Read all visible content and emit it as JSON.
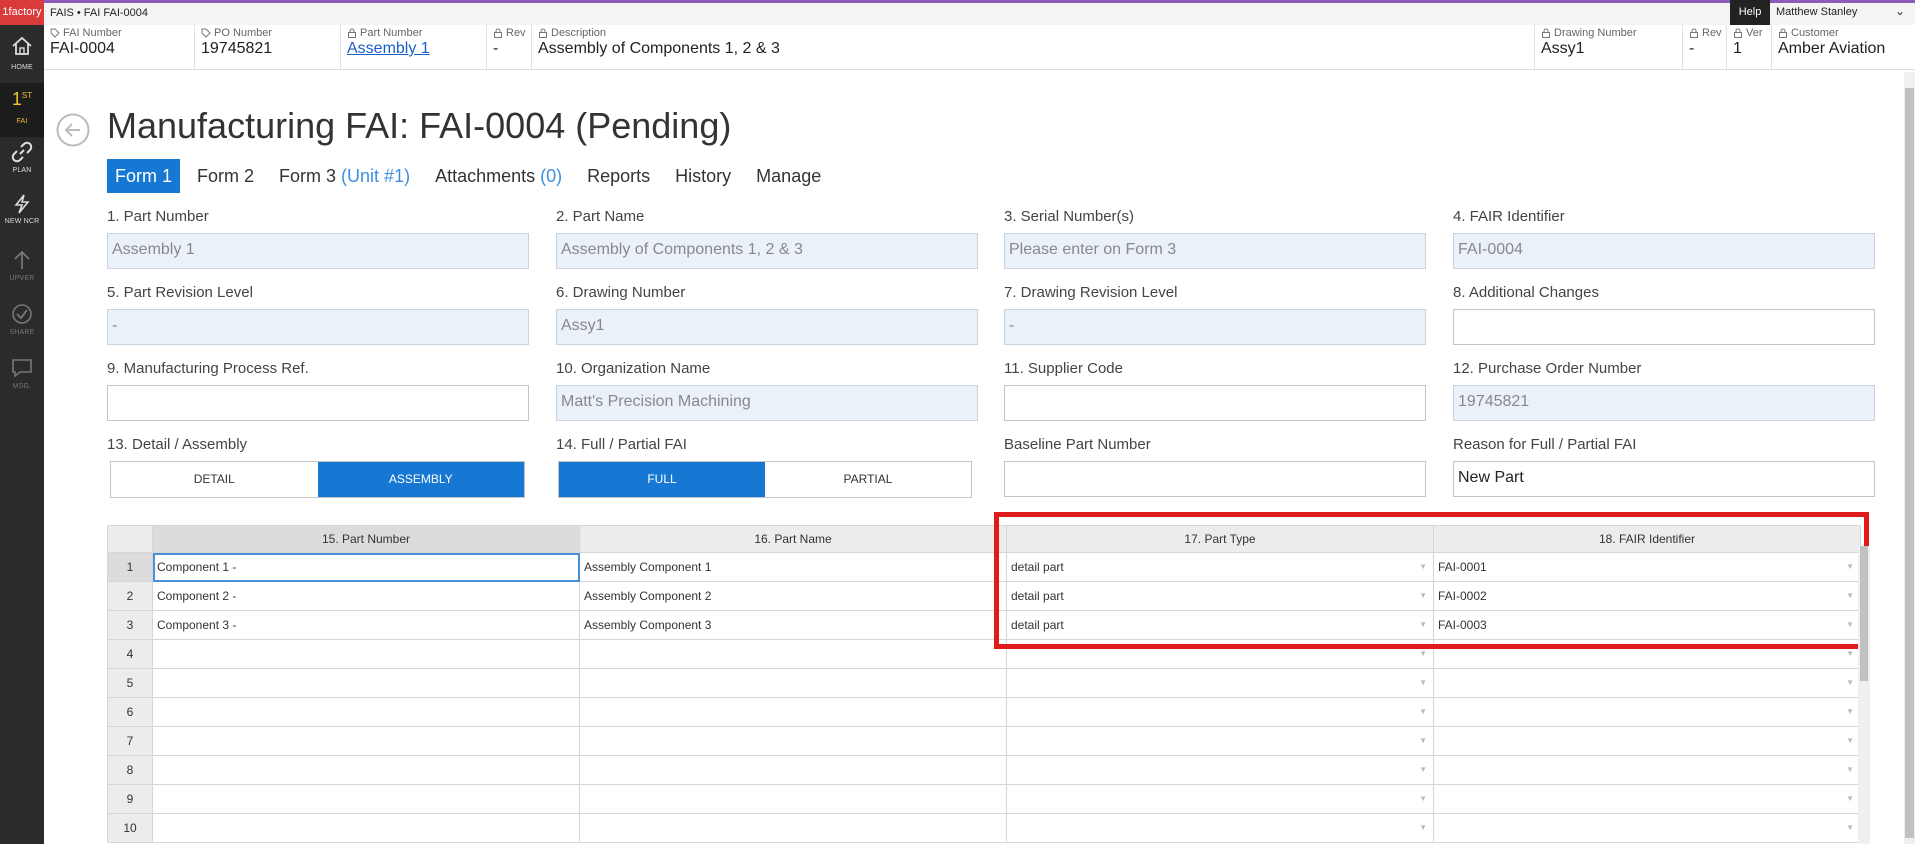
{
  "topbar": {
    "logo": "1factory",
    "breadcrumb": "FAIS • FAI FAI-0004",
    "help": "Help",
    "user": "Matthew Stanley"
  },
  "header_fields": [
    {
      "label": "FAI Number",
      "value": "FAI-0004",
      "icon": "tag-icon"
    },
    {
      "label": "PO Number",
      "value": "19745821",
      "icon": "tag-icon"
    },
    {
      "label": "Part Number",
      "value": "Assembly 1",
      "icon": "lock-icon"
    },
    {
      "label": "Rev",
      "value": "-",
      "icon": "lock-icon"
    },
    {
      "label": "Description",
      "value": "Assembly of Components 1, 2 & 3",
      "icon": "lock-icon"
    },
    {
      "label": "Drawing Number",
      "value": "Assy1",
      "icon": "lock-icon"
    },
    {
      "label": "Rev",
      "value": "-",
      "icon": "lock-icon"
    },
    {
      "label": "Ver",
      "value": "1",
      "icon": "lock-icon"
    },
    {
      "label": "Customer",
      "value": "Amber Aviation",
      "icon": "lock-icon"
    }
  ],
  "sidebar": [
    {
      "label": "HOME",
      "icon": "home-icon"
    },
    {
      "label": "FAI",
      "icon": "first-fai-icon",
      "badge": "1",
      "sup": "ST"
    },
    {
      "label": "PLAN",
      "icon": "link-icon"
    },
    {
      "label": "NEW NCR",
      "icon": "lightning-icon"
    },
    {
      "label": "UPVER",
      "icon": "up-arrow-icon"
    },
    {
      "label": "SHARE",
      "icon": "check-circle-icon"
    },
    {
      "label": "MSG.",
      "icon": "chat-icon"
    }
  ],
  "page": {
    "title": "Manufacturing FAI: FAI-0004 (Pending)"
  },
  "tabs": [
    {
      "label": "Form 1",
      "sub": ""
    },
    {
      "label": "Form 2",
      "sub": ""
    },
    {
      "label": "Form 3",
      "sub": " (Unit #1)"
    },
    {
      "label": "Attachments",
      "sub": " (0)"
    },
    {
      "label": "Reports",
      "sub": ""
    },
    {
      "label": "History",
      "sub": ""
    },
    {
      "label": "Manage",
      "sub": ""
    }
  ],
  "form": {
    "f1": {
      "label": "1. Part Number",
      "value": "Assembly 1"
    },
    "f2": {
      "label": "2. Part Name",
      "value": "Assembly of Components 1, 2 & 3"
    },
    "f3": {
      "label": "3. Serial Number(s)",
      "value": "Please enter on Form 3"
    },
    "f4": {
      "label": "4. FAIR Identifier",
      "value": "FAI-0004"
    },
    "f5": {
      "label": "5. Part Revision Level",
      "value": "-"
    },
    "f6": {
      "label": "6. Drawing Number",
      "value": "Assy1"
    },
    "f7": {
      "label": "7. Drawing Revision Level",
      "value": "-"
    },
    "f8": {
      "label": "8. Additional Changes",
      "value": ""
    },
    "f9": {
      "label": "9. Manufacturing Process Ref.",
      "value": ""
    },
    "f10": {
      "label": "10. Organization Name",
      "value": "Matt's Precision Machining"
    },
    "f11": {
      "label": "11. Supplier Code",
      "value": ""
    },
    "f12": {
      "label": "12. Purchase Order Number",
      "value": "19745821"
    },
    "f13": {
      "label": "13. Detail / Assembly",
      "options": [
        "DETAIL",
        "ASSEMBLY"
      ],
      "selected": "ASSEMBLY"
    },
    "f14": {
      "label": "14. Full / Partial FAI",
      "options": [
        "FULL",
        "PARTIAL"
      ],
      "selected": "FULL"
    },
    "baseline": {
      "label": "Baseline Part Number",
      "value": ""
    },
    "reason": {
      "label": "Reason for Full / Partial FAI",
      "value": "New Part"
    }
  },
  "grid": {
    "columns": [
      "15. Part Number",
      "16. Part Name",
      "17. Part Type",
      "18. FAIR Identifier"
    ],
    "rows": [
      [
        "1",
        "Component 1 -",
        "Assembly Component 1",
        "detail part",
        "FAI-0001"
      ],
      [
        "2",
        "Component 2 -",
        "Assembly Component 2",
        "detail part",
        "FAI-0002"
      ],
      [
        "3",
        "Component 3 -",
        "Assembly Component 3",
        "detail part",
        "FAI-0003"
      ],
      [
        "4",
        "",
        "",
        "",
        ""
      ],
      [
        "5",
        "",
        "",
        "",
        ""
      ],
      [
        "6",
        "",
        "",
        "",
        ""
      ],
      [
        "7",
        "",
        "",
        "",
        ""
      ],
      [
        "8",
        "",
        "",
        "",
        ""
      ],
      [
        "9",
        "",
        "",
        "",
        ""
      ],
      [
        "10",
        "",
        "",
        "",
        ""
      ]
    ]
  },
  "colors": {
    "accent": "#1778d4",
    "sidebar": "#2b2b2b",
    "highlight": "#e01b1b",
    "readonly_field": "#ebf1f9"
  }
}
